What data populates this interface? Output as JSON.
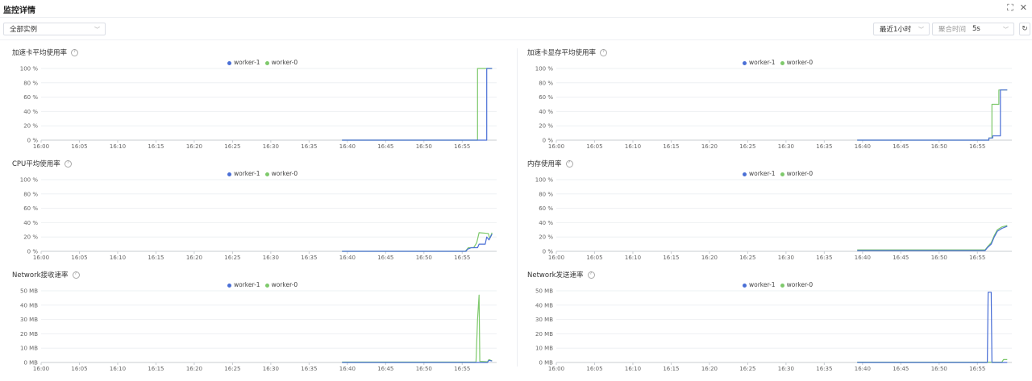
{
  "header": {
    "title": "监控详情"
  },
  "toolbar": {
    "instance_select": "全部实例",
    "time_range": "最近1小时",
    "agg_label": "聚合时间",
    "agg_value": "5s"
  },
  "colors": {
    "worker1": "#4a6fd6",
    "worker0": "#7ec96b"
  },
  "icons": {
    "fullscreen": "expand-icon",
    "close": "close-icon",
    "refresh": "refresh-icon",
    "help": "help-icon"
  },
  "legend": {
    "series1": "worker-1",
    "series0": "worker-0"
  },
  "chart_data": [
    {
      "title": "加速卡平均使用率",
      "type": "line",
      "x": [
        "16:00",
        "16:05",
        "16:10",
        "16:15",
        "16:20",
        "16:25",
        "16:30",
        "16:35",
        "16:40",
        "16:45",
        "16:50",
        "16:55"
      ],
      "y_ticks": [
        "0 %",
        "20 %",
        "40 %",
        "60 %",
        "80 %",
        "100 %"
      ],
      "ylim": [
        0,
        100
      ],
      "series": [
        {
          "name": "worker-1",
          "points": [
            [
              39.3,
              0
            ],
            [
              58.2,
              0
            ],
            [
              58.2,
              100
            ],
            [
              58.9,
              100
            ]
          ]
        },
        {
          "name": "worker-0",
          "points": [
            [
              39.3,
              0
            ],
            [
              57.0,
              0
            ],
            [
              57.0,
              100
            ],
            [
              58.9,
              100
            ]
          ]
        }
      ]
    },
    {
      "title": "加速卡显存平均使用率",
      "type": "line",
      "x": [
        "16:00",
        "16:05",
        "16:10",
        "16:15",
        "16:20",
        "16:25",
        "16:30",
        "16:35",
        "16:40",
        "16:45",
        "16:50",
        "16:55"
      ],
      "y_ticks": [
        "0 %",
        "20 %",
        "40 %",
        "60 %",
        "80 %",
        "100 %"
      ],
      "ylim": [
        0,
        100
      ],
      "series": [
        {
          "name": "worker-1",
          "points": [
            [
              39.3,
              0
            ],
            [
              56.5,
              0
            ],
            [
              56.5,
              3
            ],
            [
              57.0,
              3
            ],
            [
              57.0,
              6
            ],
            [
              58.0,
              6
            ],
            [
              58.0,
              70
            ],
            [
              58.9,
              70
            ]
          ]
        },
        {
          "name": "worker-0",
          "points": [
            [
              39.3,
              0
            ],
            [
              56.5,
              0
            ],
            [
              56.5,
              3
            ],
            [
              56.9,
              3
            ],
            [
              56.9,
              50
            ],
            [
              57.8,
              50
            ],
            [
              57.8,
              70
            ],
            [
              58.9,
              70
            ]
          ]
        }
      ]
    },
    {
      "title": "CPU平均使用率",
      "type": "line",
      "x": [
        "16:00",
        "16:05",
        "16:10",
        "16:15",
        "16:20",
        "16:25",
        "16:30",
        "16:35",
        "16:40",
        "16:45",
        "16:50",
        "16:55"
      ],
      "y_ticks": [
        "0 %",
        "20 %",
        "40 %",
        "60 %",
        "80 %",
        "100 %"
      ],
      "ylim": [
        0,
        100
      ],
      "series": [
        {
          "name": "worker-1",
          "points": [
            [
              39.3,
              0
            ],
            [
              55.5,
              0
            ],
            [
              55.7,
              3
            ],
            [
              56.2,
              5
            ],
            [
              57.0,
              5
            ],
            [
              57.2,
              10
            ],
            [
              58.0,
              10
            ],
            [
              58.2,
              20
            ],
            [
              58.5,
              16
            ],
            [
              58.9,
              24
            ]
          ]
        },
        {
          "name": "worker-0",
          "points": [
            [
              39.3,
              0
            ],
            [
              55.4,
              0
            ],
            [
              55.8,
              5
            ],
            [
              56.5,
              5
            ],
            [
              56.9,
              12
            ],
            [
              57.2,
              26
            ],
            [
              58.4,
              25
            ],
            [
              58.6,
              18
            ],
            [
              58.9,
              26
            ]
          ]
        }
      ]
    },
    {
      "title": "内存使用率",
      "type": "line",
      "x": [
        "16:00",
        "16:05",
        "16:10",
        "16:15",
        "16:20",
        "16:25",
        "16:30",
        "16:35",
        "16:40",
        "16:45",
        "16:50",
        "16:55"
      ],
      "y_ticks": [
        "0 %",
        "20 %",
        "40 %",
        "60 %",
        "80 %",
        "100 %"
      ],
      "ylim": [
        0,
        100
      ],
      "series": [
        {
          "name": "worker-1",
          "points": [
            [
              39.3,
              1
            ],
            [
              56.0,
              1
            ],
            [
              56.3,
              5
            ],
            [
              56.8,
              10
            ],
            [
              57.2,
              20
            ],
            [
              57.6,
              28
            ],
            [
              58.2,
              32
            ],
            [
              58.9,
              35
            ]
          ]
        },
        {
          "name": "worker-0",
          "points": [
            [
              39.3,
              2
            ],
            [
              56.0,
              2
            ],
            [
              56.3,
              6
            ],
            [
              56.8,
              12
            ],
            [
              57.2,
              22
            ],
            [
              57.6,
              30
            ],
            [
              58.2,
              34
            ],
            [
              58.9,
              36
            ]
          ]
        }
      ]
    },
    {
      "title": "Network接收速率",
      "type": "line",
      "x": [
        "16:00",
        "16:05",
        "16:10",
        "16:15",
        "16:20",
        "16:25",
        "16:30",
        "16:35",
        "16:40",
        "16:45",
        "16:50",
        "16:55"
      ],
      "y_ticks": [
        "0 MB",
        "10 MB",
        "20 MB",
        "30 MB",
        "40 MB",
        "50 MB"
      ],
      "ylim": [
        0,
        50
      ],
      "series": [
        {
          "name": "worker-1",
          "points": [
            [
              39.3,
              0
            ],
            [
              58.3,
              0
            ],
            [
              58.5,
              1.5
            ],
            [
              58.9,
              1
            ]
          ]
        },
        {
          "name": "worker-0",
          "points": [
            [
              39.3,
              0.3
            ],
            [
              56.8,
              0.3
            ],
            [
              57.0,
              30
            ],
            [
              57.2,
              47
            ],
            [
              57.3,
              0.8
            ],
            [
              58.3,
              0.5
            ],
            [
              58.5,
              2
            ],
            [
              58.9,
              1.2
            ]
          ]
        }
      ]
    },
    {
      "title": "Network发送速率",
      "type": "line",
      "x": [
        "16:00",
        "16:05",
        "16:10",
        "16:15",
        "16:20",
        "16:25",
        "16:30",
        "16:35",
        "16:40",
        "16:45",
        "16:50",
        "16:55"
      ],
      "y_ticks": [
        "0 MB",
        "10 MB",
        "20 MB",
        "30 MB",
        "40 MB",
        "50 MB"
      ],
      "ylim": [
        0,
        50
      ],
      "series": [
        {
          "name": "worker-1",
          "points": [
            [
              39.3,
              0
            ],
            [
              56.3,
              0
            ],
            [
              56.4,
              49
            ],
            [
              56.8,
              49
            ],
            [
              56.9,
              0
            ],
            [
              58.9,
              0
            ]
          ]
        },
        {
          "name": "worker-0",
          "points": [
            [
              39.3,
              0.2
            ],
            [
              58.2,
              0.2
            ],
            [
              58.4,
              2
            ],
            [
              58.9,
              2
            ]
          ]
        }
      ]
    }
  ]
}
